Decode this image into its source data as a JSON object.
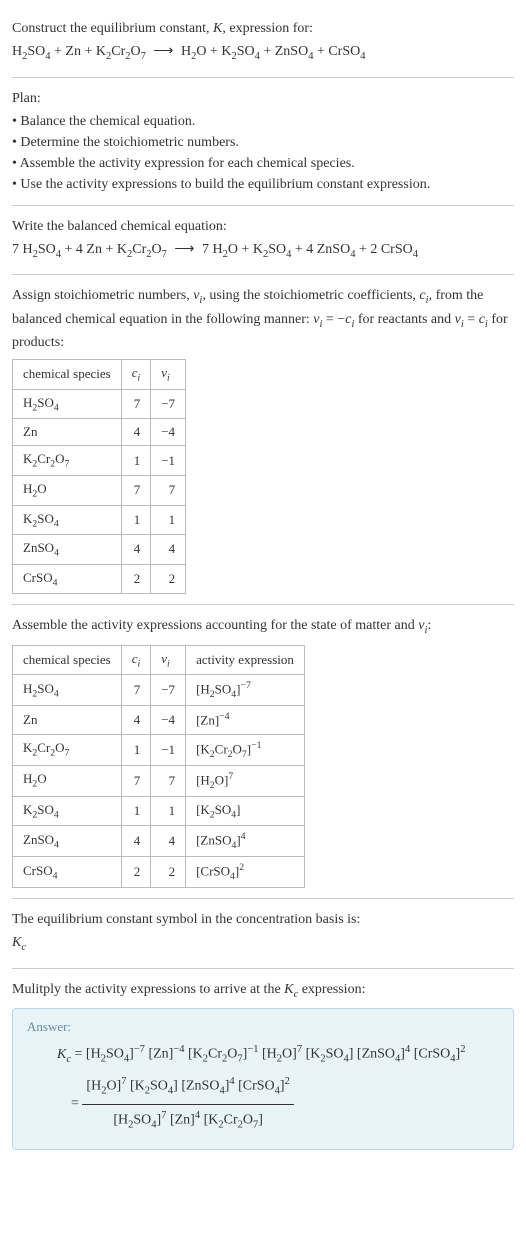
{
  "intro": {
    "line1": "Construct the equilibrium constant, K, expression for:",
    "equation": "H₂SO₄ + Zn + K₂Cr₂O₇ ⟶ H₂O + K₂SO₄ + ZnSO₄ + CrSO₄"
  },
  "plan": {
    "heading": "Plan:",
    "items": [
      "Balance the chemical equation.",
      "Determine the stoichiometric numbers.",
      "Assemble the activity expression for each chemical species.",
      "Use the activity expressions to build the equilibrium constant expression."
    ]
  },
  "balanced": {
    "heading": "Write the balanced chemical equation:",
    "equation": "7 H₂SO₄ + 4 Zn + K₂Cr₂O₇ ⟶ 7 H₂O + K₂SO₄ + 4 ZnSO₄ + 2 CrSO₄"
  },
  "stoich": {
    "heading": "Assign stoichiometric numbers, νᵢ, using the stoichiometric coefficients, cᵢ, from the balanced chemical equation in the following manner: νᵢ = −cᵢ for reactants and νᵢ = cᵢ for products:",
    "headers": [
      "chemical species",
      "cᵢ",
      "νᵢ"
    ],
    "rows": [
      {
        "species": "H₂SO₄",
        "c": "7",
        "v": "−7"
      },
      {
        "species": "Zn",
        "c": "4",
        "v": "−4"
      },
      {
        "species": "K₂Cr₂O₇",
        "c": "1",
        "v": "−1"
      },
      {
        "species": "H₂O",
        "c": "7",
        "v": "7"
      },
      {
        "species": "K₂SO₄",
        "c": "1",
        "v": "1"
      },
      {
        "species": "ZnSO₄",
        "c": "4",
        "v": "4"
      },
      {
        "species": "CrSO₄",
        "c": "2",
        "v": "2"
      }
    ]
  },
  "activity": {
    "heading": "Assemble the activity expressions accounting for the state of matter and νᵢ:",
    "headers": [
      "chemical species",
      "cᵢ",
      "νᵢ",
      "activity expression"
    ],
    "rows": [
      {
        "species": "H₂SO₄",
        "c": "7",
        "v": "−7",
        "expr": "[H₂SO₄]⁻⁷"
      },
      {
        "species": "Zn",
        "c": "4",
        "v": "−4",
        "expr": "[Zn]⁻⁴"
      },
      {
        "species": "K₂Cr₂O₇",
        "c": "1",
        "v": "−1",
        "expr": "[K₂Cr₂O₇]⁻¹"
      },
      {
        "species": "H₂O",
        "c": "7",
        "v": "7",
        "expr": "[H₂O]⁷"
      },
      {
        "species": "K₂SO₄",
        "c": "1",
        "v": "1",
        "expr": "[K₂SO₄]"
      },
      {
        "species": "ZnSO₄",
        "c": "4",
        "v": "4",
        "expr": "[ZnSO₄]⁴"
      },
      {
        "species": "CrSO₄",
        "c": "2",
        "v": "2",
        "expr": "[CrSO₄]²"
      }
    ]
  },
  "kc_symbol": {
    "heading": "The equilibrium constant symbol in the concentration basis is:",
    "value": "K_c"
  },
  "multiply": {
    "heading": "Mulitply the activity expressions to arrive at the K_c expression:"
  },
  "answer": {
    "label": "Answer:",
    "line1_lhs": "K_c =",
    "line1_rhs": "[H₂SO₄]⁻⁷ [Zn]⁻⁴ [K₂Cr₂O₇]⁻¹ [H₂O]⁷ [K₂SO₄] [ZnSO₄]⁴ [CrSO₄]²",
    "frac_eq": "=",
    "frac_num": "[H₂O]⁷ [K₂SO₄] [ZnSO₄]⁴ [CrSO₄]²",
    "frac_den": "[H₂SO₄]⁷ [Zn]⁴ [K₂Cr₂O₇]"
  }
}
